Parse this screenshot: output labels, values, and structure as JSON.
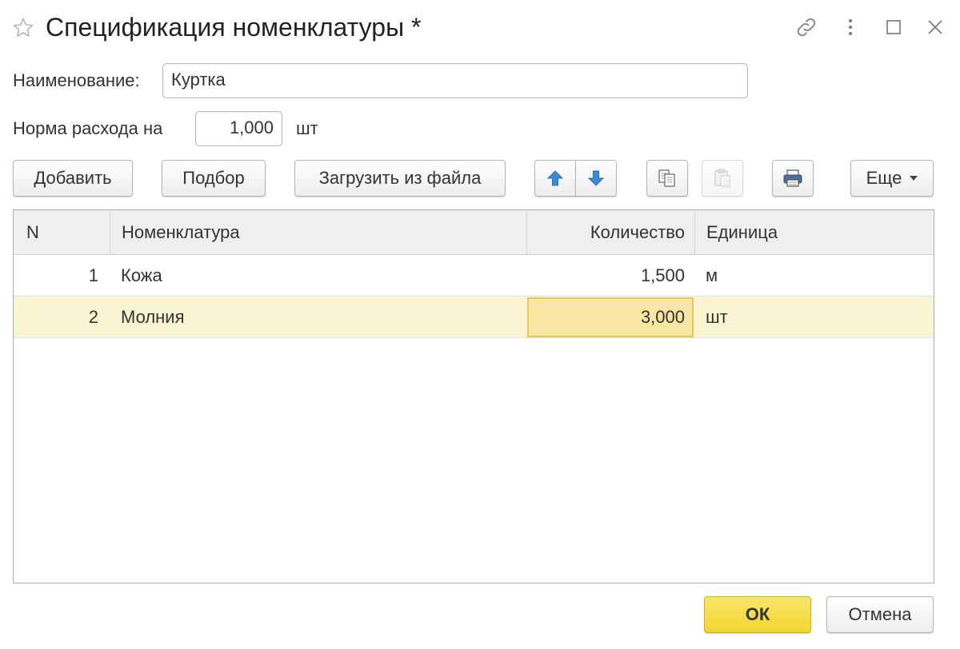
{
  "window": {
    "title": "Спецификация номенклатуры *",
    "icons": [
      "star-icon",
      "link-icon",
      "more-vertical-icon",
      "maximize-icon",
      "close-icon"
    ]
  },
  "form": {
    "name_label": "Наименование:",
    "name_value": "Куртка",
    "norm_label": "Норма расхода на",
    "norm_value": "1,000",
    "norm_unit": "шт"
  },
  "toolbar": {
    "add_label": "Добавить",
    "pick_label": "Подбор",
    "load_label": "Загрузить из файла",
    "more_label": "Еще",
    "icons": [
      "arrow-up-icon",
      "arrow-down-icon",
      "copy-icon",
      "paste-icon",
      "print-icon",
      "dropdown-caret-icon"
    ]
  },
  "table": {
    "columns": [
      "N",
      "Номенклатура",
      "Количество",
      "Единица"
    ],
    "rows": [
      {
        "n": "1",
        "item": "Кожа",
        "qty": "1,500",
        "unit": "м"
      },
      {
        "n": "2",
        "item": "Молния",
        "qty": "3,000",
        "unit": "шт",
        "selected": true
      }
    ]
  },
  "footer": {
    "ok_label": "ОК",
    "cancel_label": "Отмена"
  },
  "colors": {
    "selected_row": "#fbf4d2",
    "active_cell": "#f8e7a3",
    "ok_button": "#f2d62d",
    "arrow_blue": "#3a8ad8"
  }
}
